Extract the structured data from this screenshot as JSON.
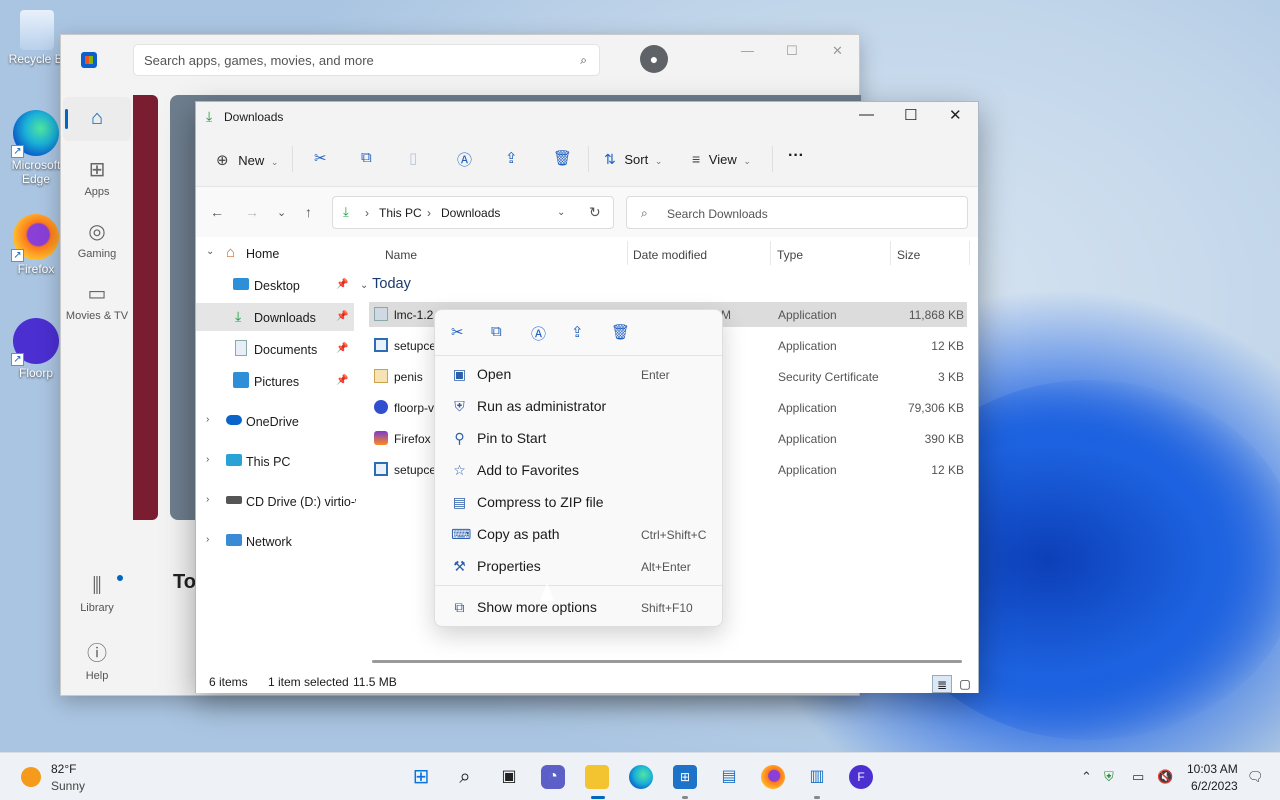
{
  "desktop": {
    "icons": [
      {
        "label": "Recycle Bi",
        "icon": "recycle-bin-icon"
      },
      {
        "label": "Microsoft Edge",
        "icon": "edge-icon"
      },
      {
        "label": "Firefox",
        "icon": "firefox-icon"
      },
      {
        "label": "Floorp",
        "icon": "floorp-icon"
      }
    ]
  },
  "store": {
    "search_placeholder": "Search apps, games, movies, and more",
    "nav": [
      {
        "label": "",
        "icon": "home-icon"
      },
      {
        "label": "Apps",
        "icon": "apps-icon"
      },
      {
        "label": "Gaming",
        "icon": "gaming-icon"
      },
      {
        "label": "Movies & TV",
        "icon": "movies-icon"
      },
      {
        "label": "Library",
        "icon": "library-icon"
      },
      {
        "label": "Help",
        "icon": "help-icon"
      }
    ],
    "section_partial": "To"
  },
  "explorer": {
    "title": "Downloads",
    "toolbar": {
      "new_label": "New",
      "sort_label": "Sort",
      "view_label": "View",
      "more_label": "···"
    },
    "address": {
      "crumb1": "This PC",
      "crumb2": "Downloads",
      "search_placeholder": "Search Downloads"
    },
    "sidebar": [
      {
        "label": "Home"
      },
      {
        "label": "Desktop"
      },
      {
        "label": "Downloads"
      },
      {
        "label": "Documents"
      },
      {
        "label": "Pictures"
      },
      {
        "label": "OneDrive"
      },
      {
        "label": "This PC"
      },
      {
        "label": "CD Drive (D:) virtio-w"
      },
      {
        "label": "Network"
      }
    ],
    "columns": {
      "name": "Name",
      "date": "Date modified",
      "type": "Type",
      "size": "Size"
    },
    "group": "Today",
    "files": [
      {
        "name": "lmc-1.2",
        "date_partial": "M",
        "type": "Application",
        "size": "11,868 KB"
      },
      {
        "name": "setupce",
        "type": "Application",
        "size": "12 KB"
      },
      {
        "name": "penis",
        "type": "Security Certificate",
        "size": "3 KB"
      },
      {
        "name": "floorp-v",
        "type": "Application",
        "size": "79,306 KB"
      },
      {
        "name": "Firefox",
        "type": "Application",
        "size": "390 KB"
      },
      {
        "name": "setupce",
        "type": "Application",
        "size": "12 KB"
      }
    ],
    "status": {
      "items": "6 items",
      "selected": "1 item selected",
      "size": "11.5 MB"
    }
  },
  "context_menu": {
    "quick_actions": [
      "cut-icon",
      "copy-icon",
      "rename-icon",
      "share-icon",
      "delete-icon"
    ],
    "items": [
      {
        "label": "Open",
        "shortcut": "Enter"
      },
      {
        "label": "Run as administrator",
        "shortcut": ""
      },
      {
        "label": "Pin to Start",
        "shortcut": ""
      },
      {
        "label": "Add to Favorites",
        "shortcut": ""
      },
      {
        "label": "Compress to ZIP file",
        "shortcut": ""
      },
      {
        "label": "Copy as path",
        "shortcut": "Ctrl+Shift+C"
      },
      {
        "label": "Properties",
        "shortcut": "Alt+Enter"
      },
      {
        "label": "Show more options",
        "shortcut": "Shift+F10"
      }
    ]
  },
  "taskbar": {
    "weather": {
      "temp": "82°F",
      "condition": "Sunny"
    },
    "clock": {
      "time": "10:03 AM",
      "date": "6/2/2023"
    }
  }
}
